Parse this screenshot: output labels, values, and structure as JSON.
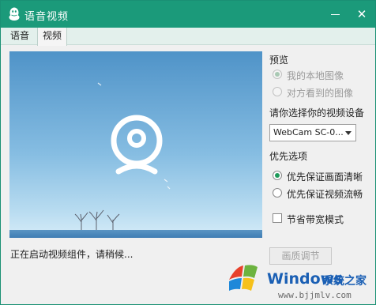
{
  "window": {
    "title": "语音视频",
    "close_symbol": "✕"
  },
  "tabs": [
    {
      "label": "语音"
    },
    {
      "label": "视频",
      "selected": true
    }
  ],
  "video": {
    "status": "正在启动视频组件，请稍候..."
  },
  "preview": {
    "label": "预览",
    "options": [
      {
        "label": "我的本地图像",
        "checked": true,
        "disabled": true
      },
      {
        "label": "对方看到的图像",
        "checked": false,
        "disabled": true
      }
    ]
  },
  "device": {
    "label": "请你选择你的视频设备",
    "selected": "WebCam SC-0..."
  },
  "priority": {
    "label": "优先选项",
    "options": [
      {
        "label": "优先保证画面清晰",
        "checked": true
      },
      {
        "label": "优先保证视频流畅",
        "checked": false
      }
    ]
  },
  "bandwidth": {
    "label": "节省带宽模式",
    "checked": false
  },
  "quality_button": {
    "label": "画质调节",
    "disabled": true
  },
  "watermark": {
    "title": "Windows",
    "subtitle": "系统之家",
    "url": "www.bjjmlv.com"
  },
  "colors": {
    "titlebar": "#1b9a7a",
    "radio_checked": "#1e9a5a",
    "watermark_blue": "#1a5fb4"
  }
}
